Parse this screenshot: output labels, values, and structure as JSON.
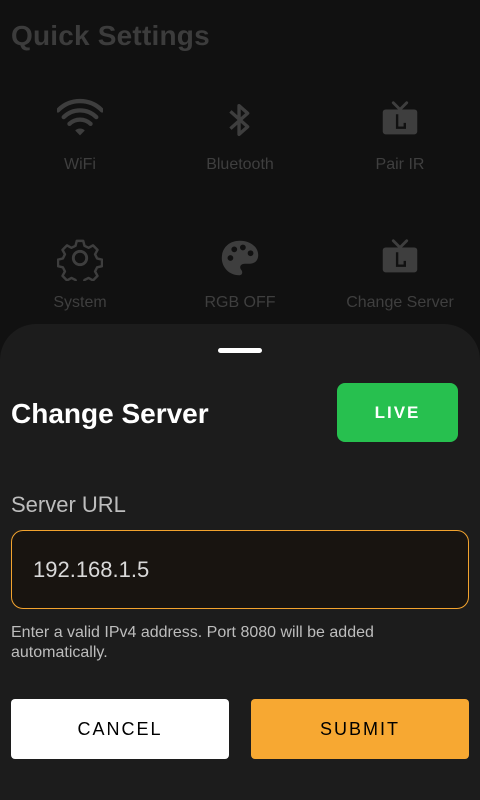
{
  "quick_settings": {
    "title": "Quick Settings",
    "tiles": [
      {
        "label": "WiFi",
        "icon": "wifi-icon"
      },
      {
        "label": "Bluetooth",
        "icon": "bluetooth-icon"
      },
      {
        "label": "Pair IR",
        "icon": "tv-icon"
      },
      {
        "label": "System",
        "icon": "gear-icon"
      },
      {
        "label": "RGB OFF",
        "icon": "palette-icon"
      },
      {
        "label": "Change Server",
        "icon": "tv-icon"
      }
    ]
  },
  "sheet": {
    "title": "Change Server",
    "live_label": "LIVE",
    "field_label": "Server URL",
    "url_value": "192.168.1.5",
    "hint": "Enter a valid IPv4 address. Port 8080 will be added automatically.",
    "cancel_label": "CANCEL",
    "submit_label": "SUBMIT"
  },
  "colors": {
    "live": "#27c04f",
    "accent": "#f7a832",
    "sheet_bg": "#1c1c1c"
  }
}
